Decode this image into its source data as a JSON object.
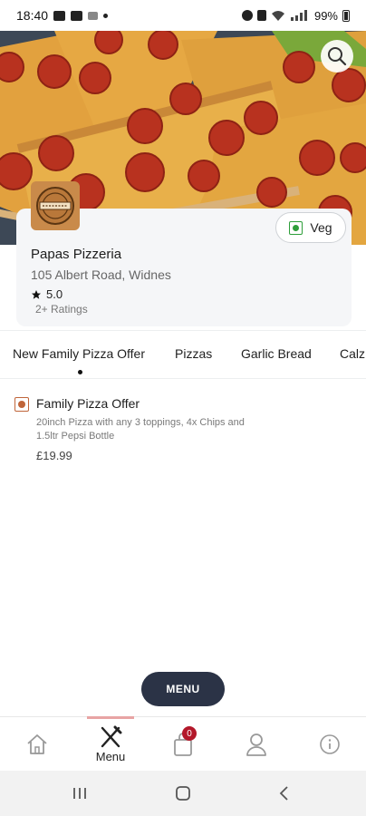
{
  "status_bar": {
    "time": "18:40",
    "battery": "99%"
  },
  "colors": {
    "accent_dark": "#2b3346",
    "veg_green": "#2e9e3a",
    "nonveg_brown": "#c0653a",
    "badge_red": "#b3182a",
    "active_tab_indicator": "#e8a4a4"
  },
  "restaurant": {
    "name": "Papas Pizzeria",
    "address": "105 Albert Road, Widnes",
    "rating": "5.0",
    "ratings_count": "2+ Ratings",
    "veg_label": "Veg"
  },
  "categories": [
    "New Family Pizza Offer",
    "Pizzas",
    "Garlic Bread",
    "Calz"
  ],
  "items": [
    {
      "name": "Family Pizza Offer",
      "description": "20inch Pizza with any 3 toppings, 4x Chips and 1.5ltr Pepsi Bottle",
      "price": "£19.99"
    }
  ],
  "menu_button": {
    "label": "MENU"
  },
  "bottom_nav": {
    "home_icon": "home-icon",
    "menu_label": "Menu",
    "cart_count": "0",
    "profile_icon": "user-icon",
    "info_icon": "info-icon"
  },
  "android_nav": {
    "recents_icon": "recents-icon",
    "home_icon": "android-home-icon",
    "back_icon": "back-icon"
  }
}
